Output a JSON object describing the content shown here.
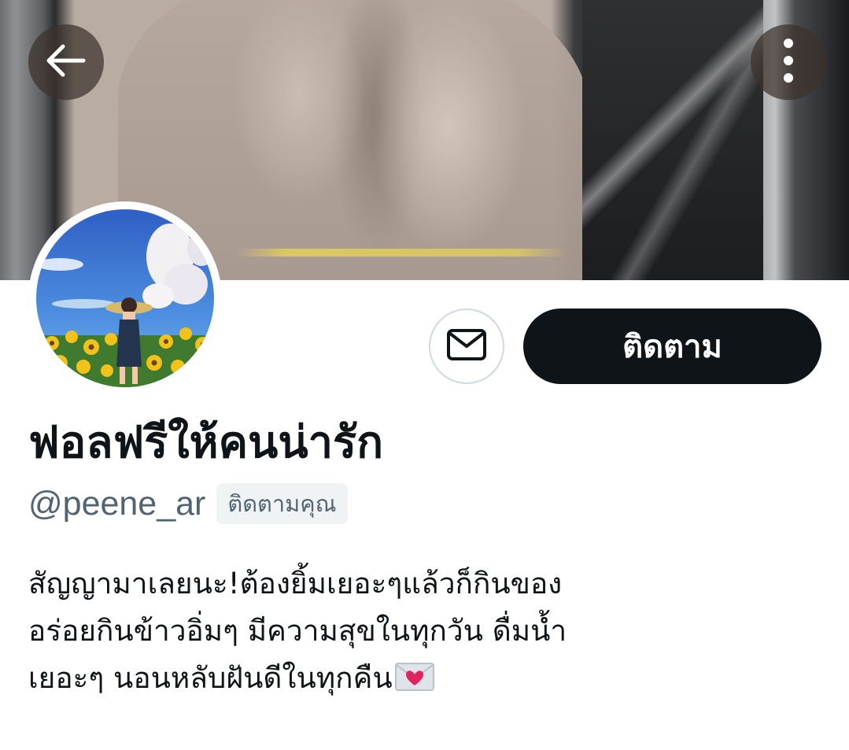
{
  "profile": {
    "display_name": "ฟอลฟรีให้คนน่ารัก",
    "handle": "@peene_ar",
    "follows_you_badge": "ติดตามคุณ",
    "bio_lines": [
      "สัญญามาเลยนะ!ต้องยิ้มเยอะๆแล้วก็กินของ",
      "อร่อยกินข้าวอิ่มๆ มีความสุขในทุกวัน ดื่มน้ำ",
      "เยอะๆ นอนหลับฝันดีในทุกคืน"
    ],
    "bio_trailing_emoji": "love-letter-emoji"
  },
  "actions": {
    "follow_label": "ติดตาม",
    "message_icon": "envelope-icon",
    "back_icon": "arrow-left-icon",
    "more_icon": "more-vertical-icon"
  },
  "colors": {
    "primary_text": "#0f1419",
    "secondary_text": "#536471",
    "follow_button_bg": "#0f1419",
    "badge_bg": "#eff3f4",
    "border": "#cfd9de"
  }
}
